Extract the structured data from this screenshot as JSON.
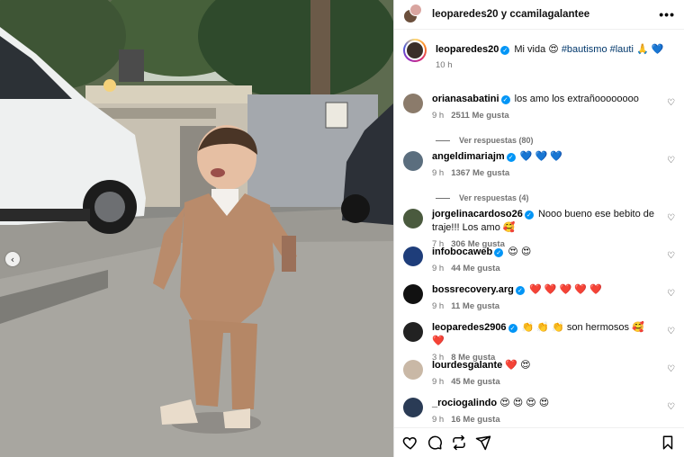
{
  "header": {
    "owner": "leoparedes20",
    "joiner": " y ",
    "collaborator": "ccamilagalantee",
    "more_label": "•••"
  },
  "caption": {
    "username": "leoparedes20",
    "text": "Mi vida 😍 ",
    "hashtags": "#bautismo #lauti",
    "emojis": " 🙏 💙",
    "time": "10 h"
  },
  "comments": [
    {
      "username": "orianasabatini",
      "verified": true,
      "text": "los amo los extrañoooooooo",
      "time": "9 h",
      "likes": "2511 Me gusta",
      "avatar_color": "#8b7b6b",
      "replies": "Ver respuestas (80)"
    },
    {
      "username": "angeldimariajm",
      "verified": true,
      "text": "💙 💙 💙",
      "time": "9 h",
      "likes": "1367 Me gusta",
      "avatar_color": "#5b6e7e",
      "replies": "Ver respuestas (4)"
    },
    {
      "username": "jorgelinacardoso26",
      "verified": true,
      "text": "Nooo bueno ese bebito de traje!!! Los amo 🥰",
      "time": "7 h",
      "likes": "306 Me gusta",
      "avatar_color": "#4a5a3e"
    },
    {
      "username": "infobocaweb",
      "verified": true,
      "text": "😍 😍",
      "time": "9 h",
      "likes": "44 Me gusta",
      "avatar_color": "#1e3d7a"
    },
    {
      "username": "bossrecovery.arg",
      "verified": true,
      "text": "❤️ ❤️ ❤️ ❤️ ❤️",
      "time": "9 h",
      "likes": "11 Me gusta",
      "avatar_color": "#111111"
    },
    {
      "username": "leoparedes2906",
      "verified": true,
      "text": "👏 👏 👏 son hermosos 🥰 ❤️",
      "time": "3 h",
      "likes": "8 Me gusta",
      "avatar_color": "#222222"
    },
    {
      "username": "lourdesgalante",
      "verified": false,
      "text": "❤️ 😍",
      "time": "9 h",
      "likes": "45 Me gusta",
      "avatar_color": "#c9b8a6"
    },
    {
      "username": "_rociogalindo",
      "verified": false,
      "text": "😍 😍 😍 😍",
      "time": "9 h",
      "likes": "16 Me gusta",
      "avatar_color": "#2a3b55"
    }
  ],
  "icons": {
    "verified": "✓",
    "heart": "♡",
    "prev": "‹"
  },
  "colors": {
    "link": "#00376b",
    "verified": "#0095f6",
    "muted": "#737373"
  }
}
